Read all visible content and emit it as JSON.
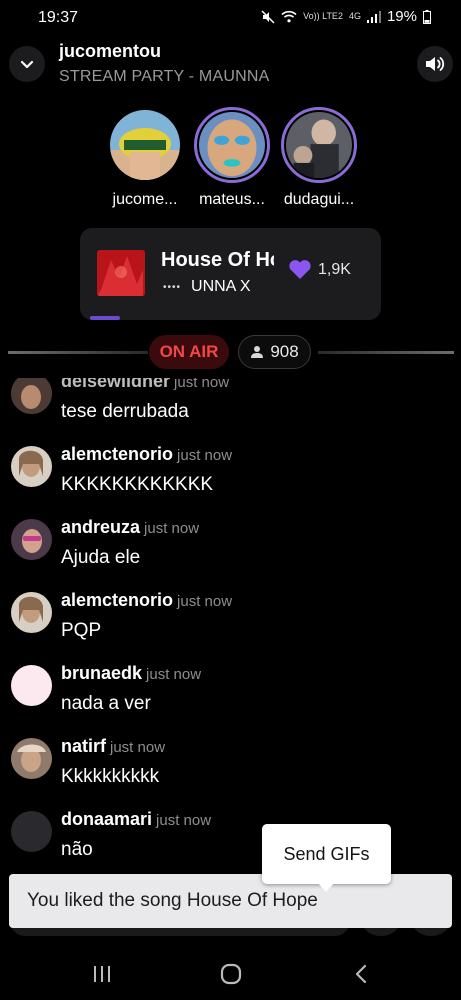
{
  "status_bar": {
    "time": "19:37",
    "network_label": "Vo)) LTE2",
    "network_type": "4G",
    "battery": "19%"
  },
  "header": {
    "title": "jucomentou",
    "subtitle": "STREAM PARTY - MAUNNA"
  },
  "participants": [
    {
      "name": "jucome...",
      "active": false
    },
    {
      "name": "mateus...",
      "active": true
    },
    {
      "name": "dudagui...",
      "active": true
    }
  ],
  "now_playing": {
    "title": "House Of Hope",
    "artist": "UNNA X",
    "like_count": "1,9K",
    "progress": 0.1,
    "accent_color": "#6c4bd3",
    "heart_color": "#8a55f0"
  },
  "live": {
    "on_air_label": "ON AIR",
    "viewer_count": "908",
    "on_air_color": "#f04848"
  },
  "chat": [
    {
      "user": "deisewildner",
      "time": "just now",
      "text": "tese derrubada"
    },
    {
      "user": "alemctenorio",
      "time": "just now",
      "text": "KKKKKKKKKKKK"
    },
    {
      "user": "andreuza",
      "time": "just now",
      "text": "Ajuda ele"
    },
    {
      "user": "alemctenorio",
      "time": "just now",
      "text": "PQP"
    },
    {
      "user": "brunaedk",
      "time": "just now",
      "text": "nada a ver"
    },
    {
      "user": "natirf",
      "time": "just now",
      "text": "Kkkkkkkkkk"
    },
    {
      "user": "donaamari",
      "time": "just now",
      "text": "não"
    }
  ],
  "toast": {
    "text": "You liked the song House Of Hope"
  },
  "tooltip": {
    "text": "Send GIFs"
  },
  "icons": {
    "collapse": "chevron-down-icon",
    "volume": "speaker-icon",
    "like": "heart-icon",
    "viewers": "person-icon",
    "nav_recents": "recents-icon",
    "nav_home": "home-icon",
    "nav_back": "back-icon"
  }
}
